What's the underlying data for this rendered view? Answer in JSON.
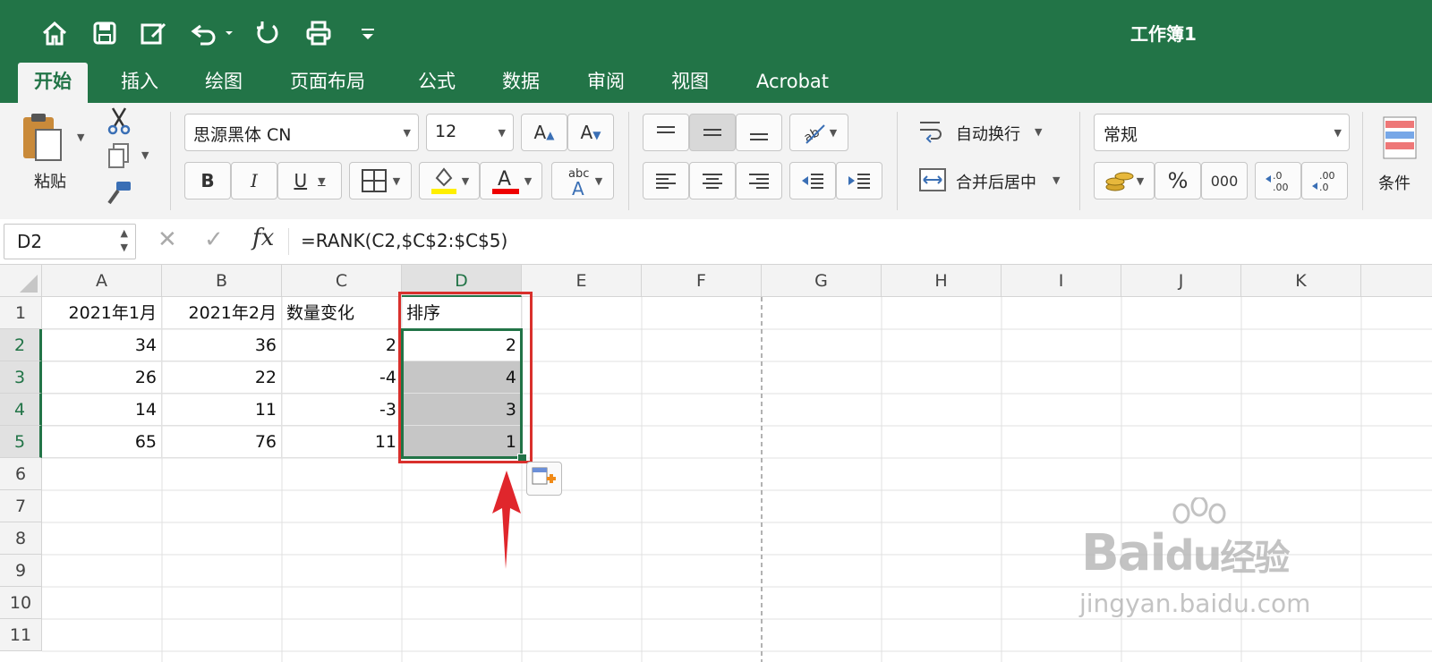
{
  "window": {
    "title": "工作簿1"
  },
  "tabs": [
    "开始",
    "插入",
    "绘图",
    "页面布局",
    "公式",
    "数据",
    "审阅",
    "视图",
    "Acrobat"
  ],
  "ribbon": {
    "paste_label": "粘贴",
    "font_name": "思源黑体 CN",
    "font_size": "12",
    "bold": "B",
    "italic": "I",
    "underline": "U",
    "wrap_text": "自动换行",
    "merge_center": "合并后居中",
    "number_format": "常规",
    "percent": "%",
    "comma": "000",
    "cond_format": "条件"
  },
  "formula_bar": {
    "name_box": "D2",
    "fx": "fx",
    "formula": "=RANK(C2,$C$2:$C$5)"
  },
  "columns": [
    "A",
    "B",
    "C",
    "D",
    "E",
    "F",
    "G",
    "H",
    "I",
    "J",
    "K"
  ],
  "rows": [
    "1",
    "2",
    "3",
    "4",
    "5",
    "6",
    "7",
    "8",
    "9",
    "10",
    "11"
  ],
  "cells": {
    "r1": [
      "2021年1月",
      "2021年2月",
      "数量变化",
      "排序"
    ],
    "r2": [
      "34",
      "36",
      "2",
      "2"
    ],
    "r3": [
      "26",
      "22",
      "-4",
      "4"
    ],
    "r4": [
      "14",
      "11",
      "-3",
      "3"
    ],
    "r5": [
      "65",
      "76",
      "11",
      "1"
    ]
  },
  "watermark": {
    "brand": "Bai",
    "brand2": "du",
    "jy": "经验",
    "url": "jingyan.baidu.com"
  },
  "colors": {
    "excel_green": "#227447",
    "highlight_red": "#d9302c",
    "selection_gray": "#c6c6c6"
  }
}
